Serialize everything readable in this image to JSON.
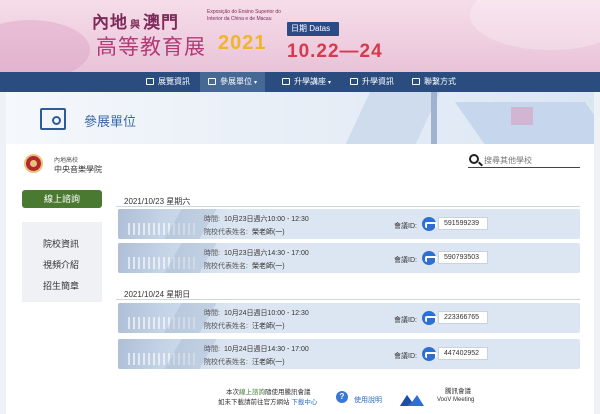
{
  "banner": {
    "title_line1_left": "內地",
    "title_line1_mid": "與",
    "title_line1_right": "澳門",
    "subtitle_pt": "Exposição do Ensino Superior do Interior da China e de Macau",
    "title_line2": "高等教育展",
    "year": "2021",
    "date_pill": "日期 Datas",
    "date_range": "10.22—24"
  },
  "nav": {
    "items": [
      {
        "label": "展覽資訊",
        "icon": "calendar-icon"
      },
      {
        "label": "參展單位",
        "icon": "building-icon",
        "dropdown": "▾"
      },
      {
        "label": "升學講座",
        "icon": "lecture-icon",
        "dropdown": "▾"
      },
      {
        "label": "升學資訊",
        "icon": "info-icon"
      },
      {
        "label": "聯繫方式",
        "icon": "contact-icon"
      }
    ]
  },
  "page": {
    "title": "參展單位",
    "school_type": "內地高校",
    "school_name": "中央音樂學院",
    "search_placeholder": "搜尋其他學校"
  },
  "sidebar": {
    "online_button": "線上諮詢",
    "links": [
      "院校資訊",
      "視頻介紹",
      "招生簡章"
    ]
  },
  "schedule": {
    "days": [
      {
        "date": "2021/10/23 星期六",
        "sessions": [
          {
            "time_label": "時間:",
            "time": "10月23日週六10:00 - 12:30",
            "rep_label": "院校代表姓名:",
            "rep": "榮老師(一)",
            "meeting_label": "會議ID:",
            "meeting_id": "591599239"
          },
          {
            "time_label": "時間:",
            "time": "10月23日週六14:30 - 17:00",
            "rep_label": "院校代表姓名:",
            "rep": "榮老師(一)",
            "meeting_label": "會議ID:",
            "meeting_id": "590793503"
          }
        ]
      },
      {
        "date": "2021/10/24 星期日",
        "sessions": [
          {
            "time_label": "時間:",
            "time": "10月24日週日10:00 - 12:30",
            "rep_label": "院校代表姓名:",
            "rep": "汪老師(一)",
            "meeting_label": "會議ID:",
            "meeting_id": "223366765"
          },
          {
            "time_label": "時間:",
            "time": "10月24日週日14:30 - 17:00",
            "rep_label": "院校代表姓名:",
            "rep": "汪老師(一)",
            "meeting_label": "會議ID:",
            "meeting_id": "447402952"
          }
        ]
      }
    ]
  },
  "footer": {
    "line1_a": "本次",
    "line1_link": "線上諮詢",
    "line1_b": "隨使用騰訊會議",
    "line2_a": "如未下載請前往官方網站 ",
    "line2_link": "下載中心",
    "help_glyph": "?",
    "help_link": "使用說明",
    "voov_title": "騰訊會議",
    "voov_name": "VooV Meeting"
  },
  "colors": {
    "navbar": "#2a4c7e",
    "accent_blue": "#3a68a8",
    "online_button": "#4a7a32",
    "card_bg": "#dce6f2",
    "date_red": "#d53a4d"
  }
}
